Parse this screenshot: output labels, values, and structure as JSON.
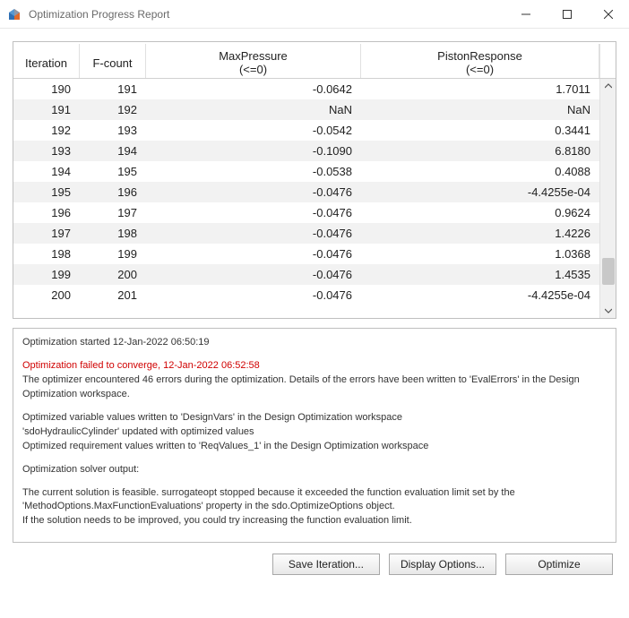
{
  "window": {
    "title": "Optimization Progress Report"
  },
  "table": {
    "headers": {
      "iteration": "Iteration",
      "fcount": "F-count",
      "maxpressure": "MaxPressure",
      "maxpressure_sub": "(<=0)",
      "piston": "PistonResponse",
      "piston_sub": "(<=0)"
    },
    "rows": [
      {
        "iteration": "190",
        "fcount": "191",
        "maxp": "-0.0642",
        "piston": "1.7011"
      },
      {
        "iteration": "191",
        "fcount": "192",
        "maxp": "NaN",
        "piston": "NaN"
      },
      {
        "iteration": "192",
        "fcount": "193",
        "maxp": "-0.0542",
        "piston": "0.3441"
      },
      {
        "iteration": "193",
        "fcount": "194",
        "maxp": "-0.1090",
        "piston": "6.8180"
      },
      {
        "iteration": "194",
        "fcount": "195",
        "maxp": "-0.0538",
        "piston": "0.4088"
      },
      {
        "iteration": "195",
        "fcount": "196",
        "maxp": "-0.0476",
        "piston": "-4.4255e-04"
      },
      {
        "iteration": "196",
        "fcount": "197",
        "maxp": "-0.0476",
        "piston": "0.9624"
      },
      {
        "iteration": "197",
        "fcount": "198",
        "maxp": "-0.0476",
        "piston": "1.4226"
      },
      {
        "iteration": "198",
        "fcount": "199",
        "maxp": "-0.0476",
        "piston": "1.0368"
      },
      {
        "iteration": "199",
        "fcount": "200",
        "maxp": "-0.0476",
        "piston": "1.4535"
      },
      {
        "iteration": "200",
        "fcount": "201",
        "maxp": "-0.0476",
        "piston": "-4.4255e-04"
      }
    ]
  },
  "log": {
    "started": "Optimization started 12-Jan-2022 06:50:19",
    "failed": "Optimization failed to converge, 12-Jan-2022 06:52:58",
    "err_detail": "The optimizer encountered 46 errors during the optimization. Details of the errors have been written to 'EvalErrors' in the Design Optimization workspace.",
    "dv": "Optimized variable values written to 'DesignVars' in the Design Optimization workspace",
    "model": "'sdoHydraulicCylinder' updated with optimized values",
    "req": "Optimized requirement values written to 'ReqValues_1' in the Design Optimization workspace",
    "solver_hdr": "Optimization solver output:",
    "solver1": "The current solution is feasible. surrogateopt stopped because it exceeded the function evaluation limit set by the 'MethodOptions.MaxFunctionEvaluations' property in the sdo.OptimizeOptions object.",
    "solver2": "If the solution needs to be improved, you could try increasing the function evaluation limit."
  },
  "buttons": {
    "save": "Save Iteration...",
    "display": "Display Options...",
    "optimize": "Optimize"
  }
}
